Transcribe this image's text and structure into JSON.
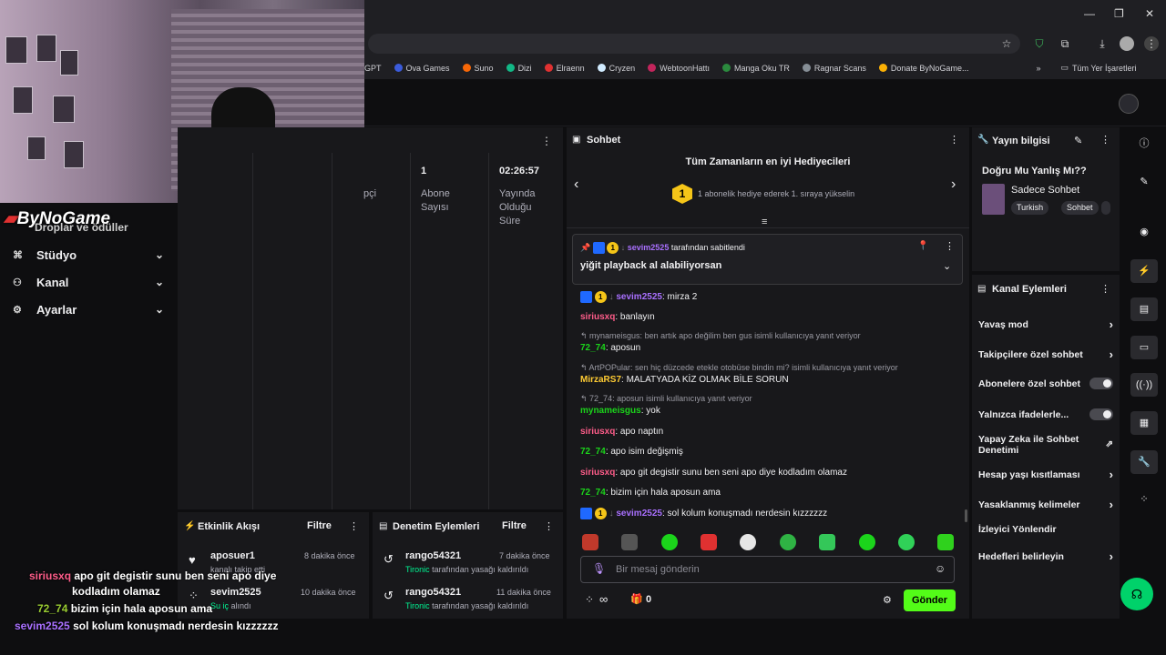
{
  "browser": {
    "bookmarks": [
      "GPT",
      "Ova Games",
      "Suno",
      "Dizi",
      "Elraenn",
      "Cryzen",
      "WebtoonHattı",
      "Manga Oku TR",
      "Ragnar Scans",
      "Donate ByNoGame..."
    ],
    "all_bookmarks": "Tüm Yer İşaretleri",
    "overflow": "»"
  },
  "nav": {
    "brand": "ByNoGame",
    "partial_item": "Droplar ve ödüller",
    "items": [
      "Stüdyo",
      "Kanal",
      "Ayarlar"
    ]
  },
  "stats": {
    "partial_label": "pçi",
    "col1_value": "1",
    "col1_label_1": "Abone",
    "col1_label_2": "Sayısı",
    "col2_value": "02:26:57",
    "col2_label_1": "Yayında",
    "col2_label_2": "Olduğu",
    "col2_label_3": "Süre"
  },
  "activity": {
    "title": "Etkinlik Akışı",
    "filter": "Filtre",
    "rows": [
      {
        "name": "aposuer1",
        "time": "8 dakika önce",
        "sub": "kanalı takip etti",
        "sub_green": ""
      },
      {
        "name": "sevim2525",
        "time": "10 dakika önce",
        "sub": " alındı",
        "sub_green": "Su iç"
      }
    ]
  },
  "moderation": {
    "title": "Denetim Eylemleri",
    "filter": "Filtre",
    "rows": [
      {
        "name": "rango54321",
        "time": "7 dakika önce",
        "actor": "Tironic",
        "action": " tarafından yasağı kaldırıldı"
      },
      {
        "name": "rango54321",
        "time": "11 dakika önce",
        "actor": "Tironic",
        "action": " tarafından yasağı kaldırıldı"
      }
    ]
  },
  "chat": {
    "title": "Sohbet",
    "gifters_title": "Tüm Zamanların en iyi Hediyecileri",
    "gifters_rank": "1",
    "gifters_sub": "1 abonelik hediye ederek 1. sıraya yükselin",
    "pinned_by_user": "sevim2525",
    "pinned_by_text": " tarafından sabitlendi",
    "pinned_message": "yiğit playback al alabiliyorsan",
    "messages": [
      {
        "type": "msg",
        "user": "sevim2525",
        "color": "purple",
        "text": ": mirza 2",
        "badges": true
      },
      {
        "type": "msg",
        "user": "siriusxq",
        "color": "pink",
        "text": ": banlayın"
      },
      {
        "type": "reply",
        "text": "↰ mynameisgus: ben artık apo değilim ben gus isimli kullanıcıya yanıt veriyor"
      },
      {
        "type": "msg",
        "user": "72_74",
        "color": "green",
        "text": ": aposun"
      },
      {
        "type": "reply",
        "text": "↰ ArtPOPular: sen hiç düzcede etekle otobüse bindin mi? isimli kullanıcıya yanıt veriyor"
      },
      {
        "type": "msg",
        "user": "MirzaRS7",
        "color": "yellow",
        "text": ": MALATYADA KİZ OLMAK BİLE SORUN"
      },
      {
        "type": "reply",
        "text": "↰ 72_74: aposun isimli kullanıcıya yanıt veriyor"
      },
      {
        "type": "msg",
        "user": "mynameisgus",
        "color": "green",
        "text": ": yok"
      },
      {
        "type": "msg",
        "user": "siriusxq",
        "color": "pink",
        "text": ": apo naptın"
      },
      {
        "type": "msg",
        "user": "72_74",
        "color": "green",
        "text": ": apo isim değişmiş"
      },
      {
        "type": "msg",
        "user": "siriusxq",
        "color": "pink",
        "text": ": apo git degistir sunu ben seni apo diye kodladım olamaz"
      },
      {
        "type": "msg",
        "user": "72_74",
        "color": "green",
        "text": ": bizim için hala aposun ama"
      },
      {
        "type": "msg",
        "user": "sevim2525",
        "color": "purple",
        "text": ": sol kolum konuşmadı nerdesin kızzzzzz",
        "badges": true
      }
    ],
    "input_placeholder": "Bir mesaj gönderin",
    "infinity": "∞",
    "gift_count": "0",
    "send_label": "Gönder"
  },
  "stream_info": {
    "title": "Yayın bilgisi",
    "stream_title": "Doğru Mu Yanlış Mı??",
    "category": "Sadece Sohbet",
    "tags": [
      "Turkish",
      "Sohbet"
    ]
  },
  "channel_actions": {
    "title": "Kanal Eylemleri",
    "items": [
      {
        "label": "Yavaş mod",
        "control": "arrow"
      },
      {
        "label": "Takipçilere özel sohbet",
        "control": "arrow"
      },
      {
        "label": "Abonelere özel sohbet",
        "control": "toggle"
      },
      {
        "label": "Yalnızca ifadelerle...",
        "control": "toggle"
      },
      {
        "label": "Yapay Zeka ile Sohbet Denetimi",
        "control": "external"
      },
      {
        "label": "Hesap yaşı kısıtlaması",
        "control": "arrow"
      },
      {
        "label": "Yasaklanmış kelimeler",
        "control": "arrow"
      },
      {
        "label": "İzleyici Yönlendir",
        "control": "none"
      },
      {
        "label": "Hedefleri belirleyin",
        "control": "arrow"
      }
    ]
  },
  "overlay_chat": [
    {
      "user": "siriusxq",
      "color": "#ff5d8a",
      "text": "apo git degistir sunu ben seni apo diye"
    },
    {
      "user": "",
      "color": "",
      "text": "kodladım olamaz"
    },
    {
      "user": "72_74",
      "color": "#9acd32",
      "text": "bizim için hala aposun ama"
    },
    {
      "user": "sevim2525",
      "color": "#a970ff",
      "text": "sol kolum konuşmadı nerdesin kızzzzzz"
    }
  ]
}
